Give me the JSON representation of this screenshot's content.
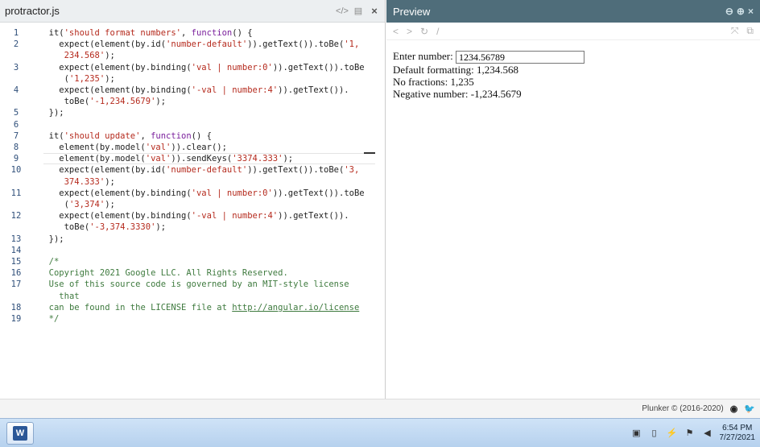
{
  "editor": {
    "file_name": "protractor.js",
    "tools": {
      "code_icon": "</>",
      "doc_icon": "doc-icon",
      "close_icon": "×"
    },
    "lines": [
      {
        "num": "1",
        "html": "  it(<span class=\"str\">'should format numbers'</span>, <span class=\"kw\">function</span>() {"
      },
      {
        "num": "2",
        "html": "    expect(element(by.id(<span class=\"str\">'number-default'</span>)).getText()).toBe(<span class=\"str\">'1,</span>"
      },
      {
        "num": "",
        "html": "     <span class=\"str\">234.568'</span>);"
      },
      {
        "num": "3",
        "html": "    expect(element(by.binding(<span class=\"str\">'val | number:0'</span>)).getText()).toBe"
      },
      {
        "num": "",
        "html": "     (<span class=\"str\">'1,235'</span>);"
      },
      {
        "num": "4",
        "html": "    expect(element(by.binding(<span class=\"str\">'-val | number:4'</span>)).getText())."
      },
      {
        "num": "",
        "html": "     toBe(<span class=\"str\">'-1,234.5679'</span>);"
      },
      {
        "num": "5",
        "html": "  });"
      },
      {
        "num": "6",
        "html": ""
      },
      {
        "num": "7",
        "html": "  it(<span class=\"str\">'should update'</span>, <span class=\"kw\">function</span>() {"
      },
      {
        "num": "8",
        "html": "    element(by.model(<span class=\"str\">'val'</span>)).clear();"
      },
      {
        "num": "9",
        "html": "    element(by.model(<span class=\"str\">'val'</span>)).sendKeys(<span class=\"str\">'3374.333'</span>);",
        "active": true
      },
      {
        "num": "10",
        "html": "    expect(element(by.id(<span class=\"str\">'number-default'</span>)).getText()).toBe(<span class=\"str\">'3,</span>"
      },
      {
        "num": "",
        "html": "     <span class=\"str\">374.333'</span>);"
      },
      {
        "num": "11",
        "html": "    expect(element(by.binding(<span class=\"str\">'val | number:0'</span>)).getText()).toBe"
      },
      {
        "num": "",
        "html": "     (<span class=\"str\">'3,374'</span>);"
      },
      {
        "num": "12",
        "html": "    expect(element(by.binding(<span class=\"str\">'-val | number:4'</span>)).getText())."
      },
      {
        "num": "",
        "html": "     toBe(<span class=\"str\">'-3,374.3330'</span>);"
      },
      {
        "num": "13",
        "html": "  });"
      },
      {
        "num": "14",
        "html": ""
      },
      {
        "num": "15",
        "html": "  <span class=\"cm\">/*</span>"
      },
      {
        "num": "16",
        "html": "  <span class=\"cm\">Copyright 2021 Google LLC. All Rights Reserved.</span>"
      },
      {
        "num": "17",
        "html": "  <span class=\"cm\">Use of this source code is governed by an MIT-style license</span>"
      },
      {
        "num": "",
        "html": "    <span class=\"cm\">that</span>"
      },
      {
        "num": "18",
        "html": "  <span class=\"cm\">can be found in the LICENSE file at </span><span class=\"cm-link\">http://angular.io/license</span>"
      },
      {
        "num": "19",
        "html": "  <span class=\"cm\">*/</span>"
      }
    ]
  },
  "preview": {
    "title": "Preview",
    "zoom_out_icon": "⊖",
    "zoom_in_icon": "⊕",
    "close_icon": "×",
    "nav": {
      "back": "<",
      "forward": ">",
      "refresh": "↻",
      "path": "/",
      "expand": "⤧",
      "copy": "⧉"
    },
    "input_label": "Enter number:",
    "input_value": "1234.56789",
    "default_label": "Default formatting:",
    "default_value": "1,234.568",
    "nofrac_label": "No fractions:",
    "nofrac_value": "1,235",
    "negative_label": "Negative number:",
    "negative_value": "-1,234.5679"
  },
  "footer": {
    "text": "Plunker © (2016-2020)",
    "github_icon": "◉",
    "twitter_icon": "♥"
  },
  "taskbar": {
    "word_label": "W",
    "tray": {
      "icon1": "▣",
      "icon2": "▯",
      "network": "⚡",
      "flag": "⚑",
      "volume": "◀"
    },
    "time": "6:54 PM",
    "date": "7/27/2021"
  }
}
